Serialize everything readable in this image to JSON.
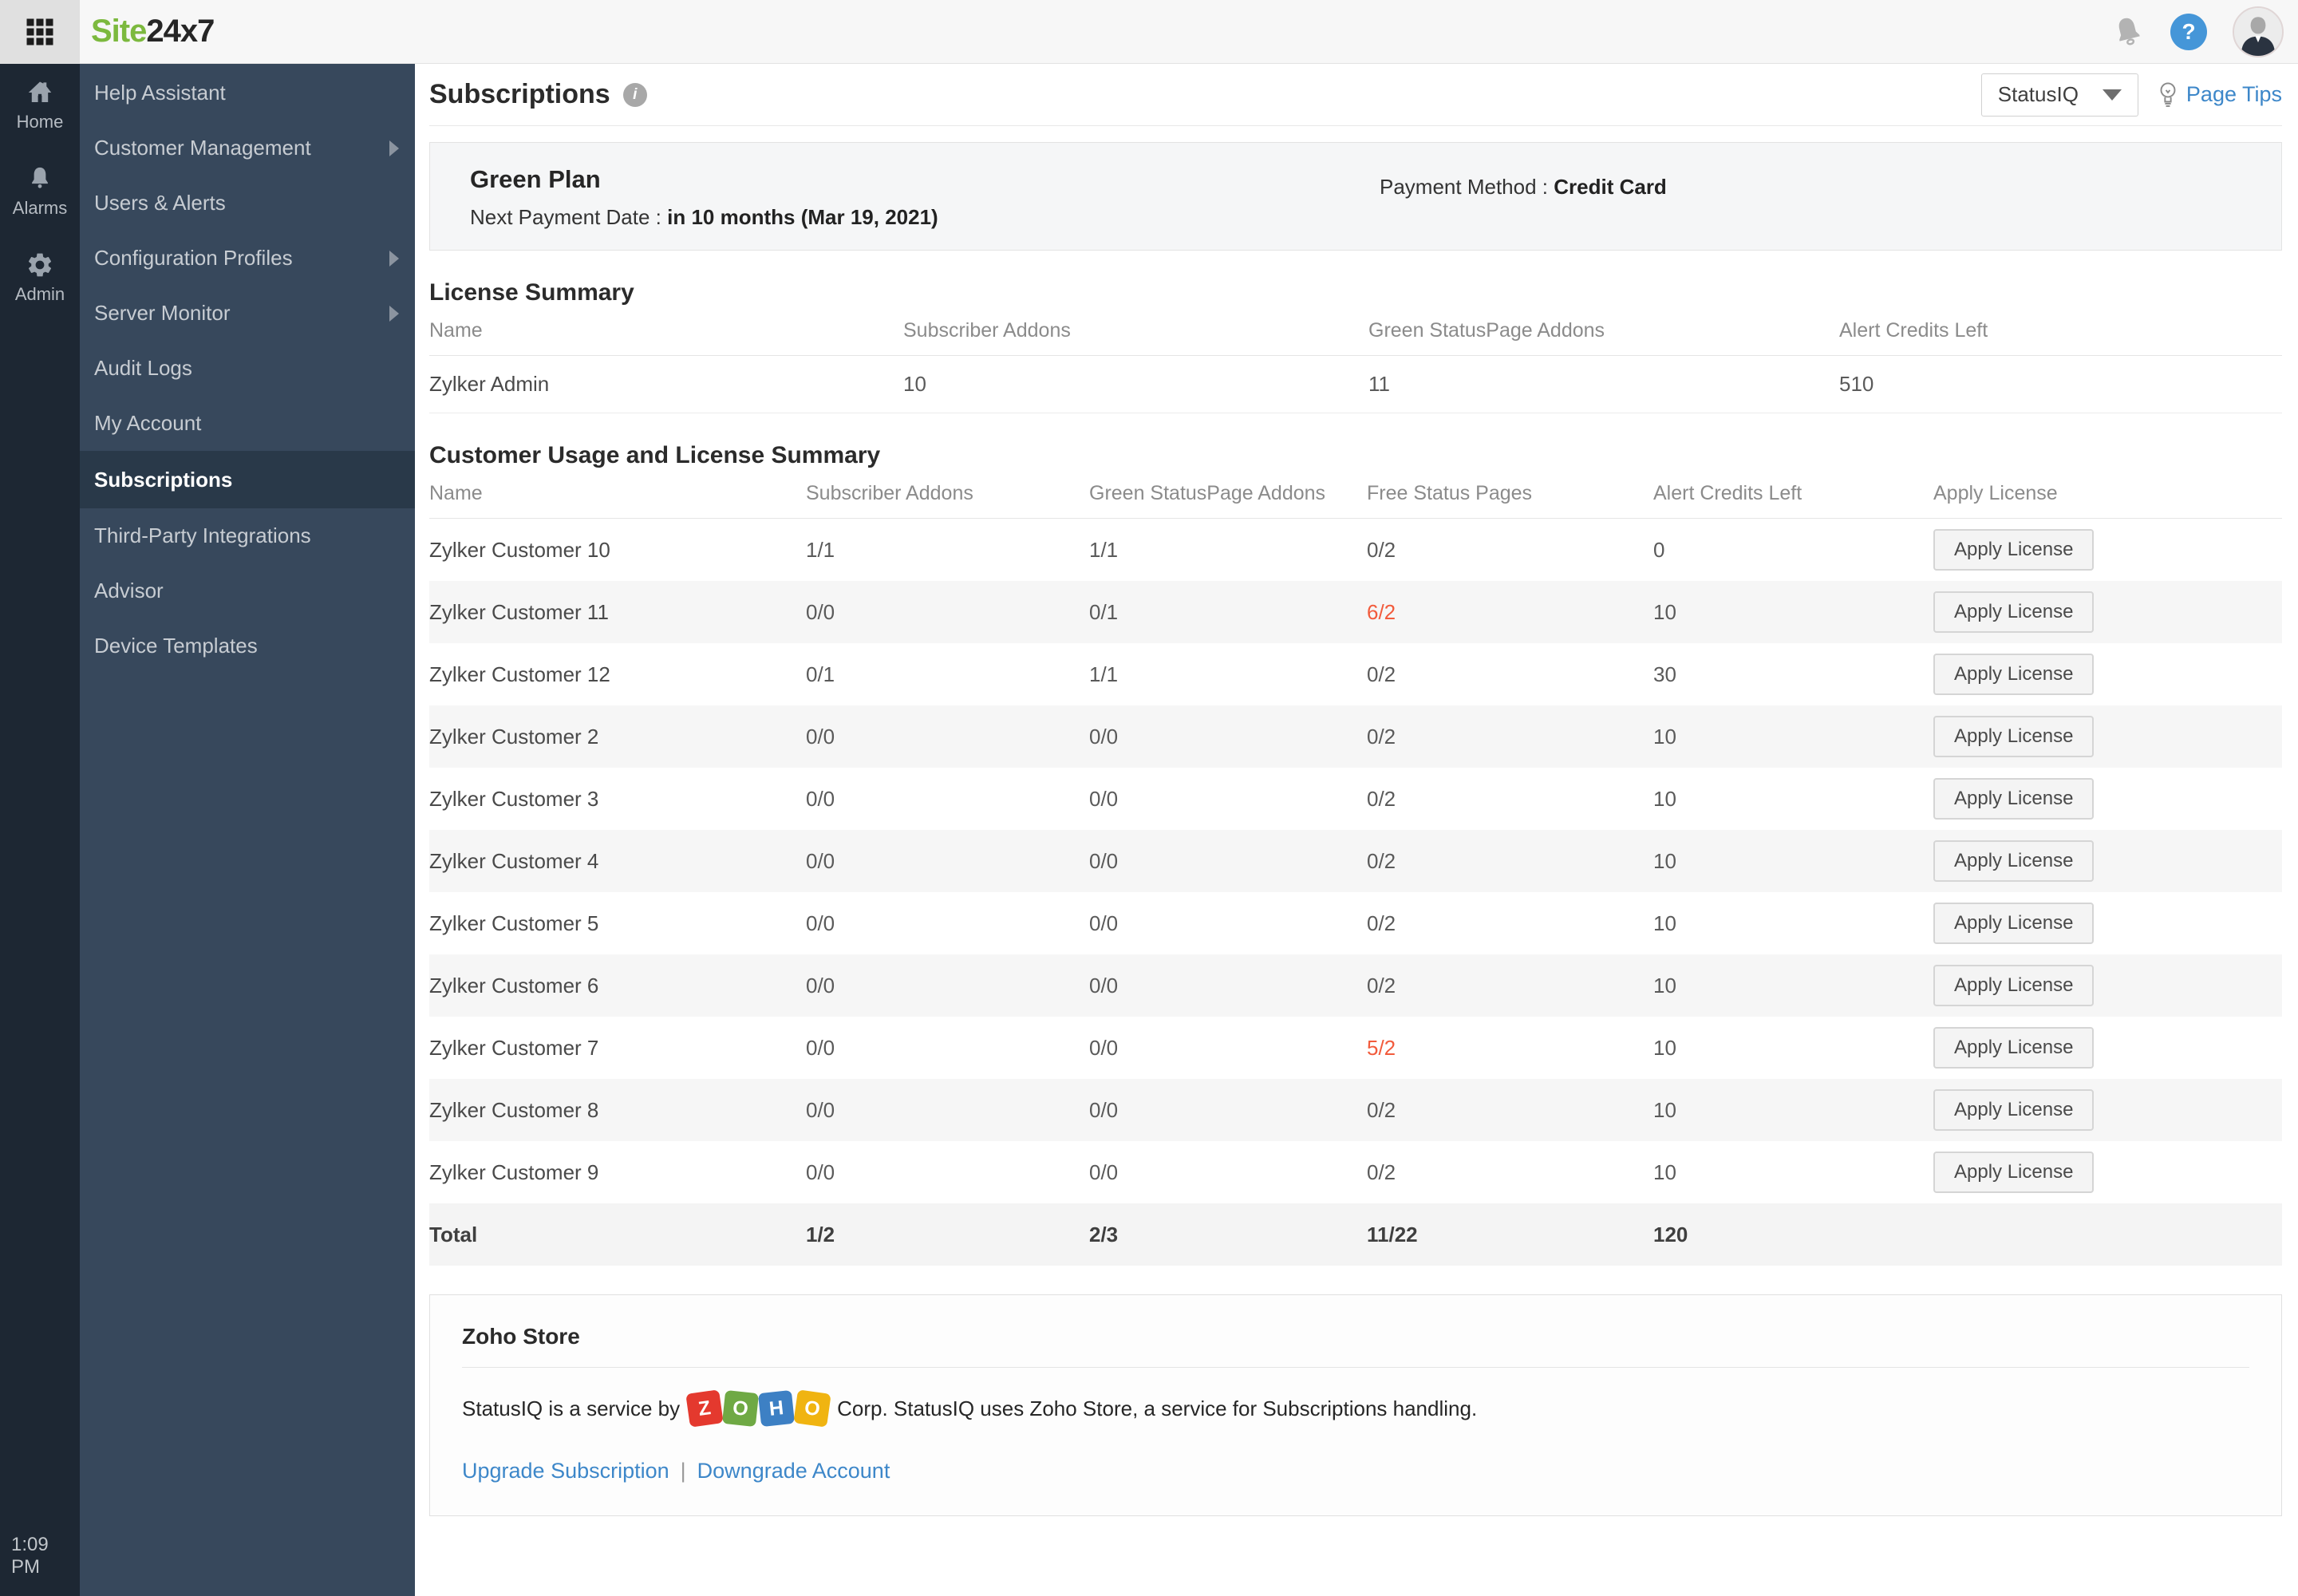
{
  "topbar": {
    "logo_site": "Site",
    "logo_24x7": "24x7"
  },
  "rail": {
    "items": [
      {
        "label": "Home"
      },
      {
        "label": "Alarms"
      },
      {
        "label": "Admin"
      }
    ],
    "time": "1:09 PM"
  },
  "sidebar": {
    "items": [
      {
        "label": "Help Assistant",
        "has_submenu": false,
        "selected": false
      },
      {
        "label": "Customer Management",
        "has_submenu": true,
        "selected": false
      },
      {
        "label": "Users & Alerts",
        "has_submenu": false,
        "selected": false
      },
      {
        "label": "Configuration Profiles",
        "has_submenu": true,
        "selected": false
      },
      {
        "label": "Server Monitor",
        "has_submenu": true,
        "selected": false
      },
      {
        "label": "Audit Logs",
        "has_submenu": false,
        "selected": false
      },
      {
        "label": "My Account",
        "has_submenu": false,
        "selected": false
      },
      {
        "label": "Subscriptions",
        "has_submenu": false,
        "selected": true
      },
      {
        "label": "Third-Party Integrations",
        "has_submenu": false,
        "selected": false
      },
      {
        "label": "Advisor",
        "has_submenu": false,
        "selected": false
      },
      {
        "label": "Device Templates",
        "has_submenu": false,
        "selected": false
      }
    ]
  },
  "header": {
    "title": "Subscriptions",
    "dropdown_value": "StatusIQ",
    "page_tips": "Page Tips"
  },
  "plan": {
    "name": "Green Plan",
    "next_payment_label": "Next Payment Date :",
    "next_payment_value": "in 10 months (Mar 19, 2021)",
    "payment_method_label": "Payment Method :",
    "payment_method_value": "Credit Card"
  },
  "license_summary": {
    "title": "License Summary",
    "columns": [
      "Name",
      "Subscriber Addons",
      "Green StatusPage Addons",
      "Alert Credits Left"
    ],
    "row": {
      "name": "Zylker Admin",
      "subscriber_addons": "10",
      "green_statuspage_addons": "11",
      "alert_credits_left": "510"
    }
  },
  "customer_table": {
    "title": "Customer Usage and License Summary",
    "columns": [
      "Name",
      "Subscriber Addons",
      "Green StatusPage Addons",
      "Free Status Pages",
      "Alert Credits Left",
      "Apply License"
    ],
    "apply_button_label": "Apply License",
    "rows": [
      {
        "name": "Zylker Customer 10",
        "subscriber_addons": "1/1",
        "green_statuspage_addons": "1/1",
        "free_status_pages": "0/2",
        "free_alert": false,
        "alert_credits_left": "0"
      },
      {
        "name": "Zylker Customer 11",
        "subscriber_addons": "0/0",
        "green_statuspage_addons": "0/1",
        "free_status_pages": "6/2",
        "free_alert": true,
        "alert_credits_left": "10"
      },
      {
        "name": "Zylker Customer 12",
        "subscriber_addons": "0/1",
        "green_statuspage_addons": "1/1",
        "free_status_pages": "0/2",
        "free_alert": false,
        "alert_credits_left": "30"
      },
      {
        "name": "Zylker Customer 2",
        "subscriber_addons": "0/0",
        "green_statuspage_addons": "0/0",
        "free_status_pages": "0/2",
        "free_alert": false,
        "alert_credits_left": "10"
      },
      {
        "name": "Zylker Customer 3",
        "subscriber_addons": "0/0",
        "green_statuspage_addons": "0/0",
        "free_status_pages": "0/2",
        "free_alert": false,
        "alert_credits_left": "10"
      },
      {
        "name": "Zylker Customer 4",
        "subscriber_addons": "0/0",
        "green_statuspage_addons": "0/0",
        "free_status_pages": "0/2",
        "free_alert": false,
        "alert_credits_left": "10"
      },
      {
        "name": "Zylker Customer 5",
        "subscriber_addons": "0/0",
        "green_statuspage_addons": "0/0",
        "free_status_pages": "0/2",
        "free_alert": false,
        "alert_credits_left": "10"
      },
      {
        "name": "Zylker Customer 6",
        "subscriber_addons": "0/0",
        "green_statuspage_addons": "0/0",
        "free_status_pages": "0/2",
        "free_alert": false,
        "alert_credits_left": "10"
      },
      {
        "name": "Zylker Customer 7",
        "subscriber_addons": "0/0",
        "green_statuspage_addons": "0/0",
        "free_status_pages": "5/2",
        "free_alert": true,
        "alert_credits_left": "10"
      },
      {
        "name": "Zylker Customer 8",
        "subscriber_addons": "0/0",
        "green_statuspage_addons": "0/0",
        "free_status_pages": "0/2",
        "free_alert": false,
        "alert_credits_left": "10"
      },
      {
        "name": "Zylker Customer 9",
        "subscriber_addons": "0/0",
        "green_statuspage_addons": "0/0",
        "free_status_pages": "0/2",
        "free_alert": false,
        "alert_credits_left": "10"
      }
    ],
    "total": {
      "label": "Total",
      "subscriber_addons": "1/2",
      "green_statuspage_addons": "2/3",
      "free_status_pages": "11/22",
      "alert_credits_left": "120"
    }
  },
  "zoho_store": {
    "title": "Zoho Store",
    "text_before": "StatusIQ is a service by",
    "logo_letters": [
      "Z",
      "O",
      "H",
      "O"
    ],
    "text_after": "Corp.  StatusIQ uses Zoho Store, a service for Subscriptions handling.",
    "links": [
      {
        "label": "Upgrade Subscription"
      },
      {
        "label": "Downgrade Account"
      }
    ],
    "separator": "|"
  },
  "colors": {
    "brand_green": "#7cb93e",
    "link_blue": "#3d87c9",
    "alert_red": "#f25b3c",
    "sidebar_bg": "#37485c",
    "rail_bg": "#1d2733"
  }
}
